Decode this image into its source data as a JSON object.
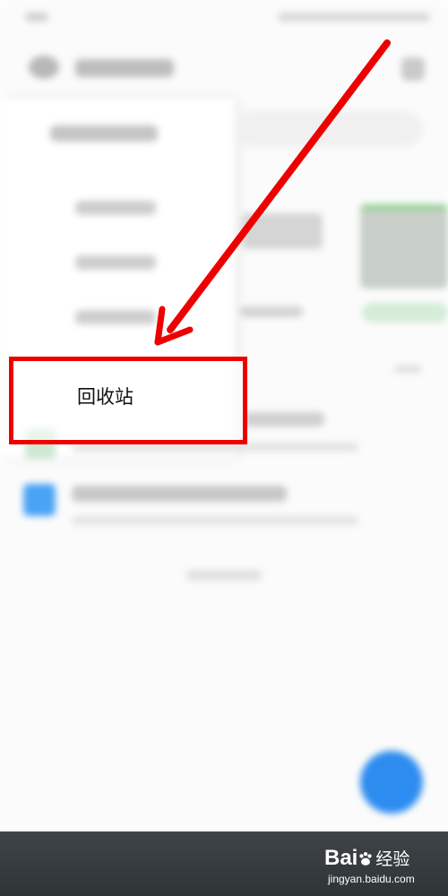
{
  "menu": {
    "items": [
      {
        "label": "回收站"
      }
    ]
  },
  "watermark": {
    "brand": "Bai",
    "brand_suffix": "经验",
    "url": "jingyan.baidu.com"
  },
  "colors": {
    "highlight": "#ee0000",
    "fab": "#2d8cf0",
    "bottom_bar": "#353a3d"
  },
  "icons": {
    "fab": "plus-icon",
    "watermark": "baidu-paw-icon"
  }
}
